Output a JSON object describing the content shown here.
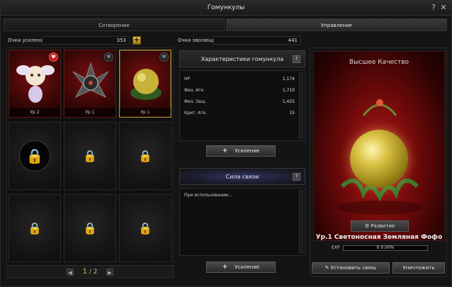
{
  "window": {
    "title": "Гомункулы"
  },
  "tabs": [
    {
      "label": "Сотворение"
    },
    {
      "label": "Управление"
    }
  ],
  "stats": {
    "enhance_label": "Очки усиления",
    "enhance_value": "353",
    "evolve_label": "Очки эволюции",
    "evolve_value": "441"
  },
  "slots": [
    {
      "level": "Ур 2",
      "favorite": true
    },
    {
      "level": "Ур 1",
      "favorite": false
    },
    {
      "level": "Ур 1",
      "favorite": false
    }
  ],
  "pager": {
    "current": "1",
    "total": "/ 2"
  },
  "attributes": {
    "title": "Характеристики гомункула",
    "rows": [
      {
        "label": "HP",
        "value": "1,174"
      },
      {
        "label": "Физ. Атк.",
        "value": "1,710"
      },
      {
        "label": "Физ. Защ.",
        "value": "1,425"
      },
      {
        "label": "Крит. Атк.",
        "value": "15"
      }
    ],
    "button": "Усиление"
  },
  "bond": {
    "title": "Сила связи",
    "text": "При использовании...",
    "button": "Усиление"
  },
  "detail": {
    "quality": "Высшее Качество",
    "evolve_button": "Развитие",
    "name": "Ур.1 Светоносная Земляная Фофо",
    "exp_label": "EXP",
    "exp_value": "0 0.00%",
    "bind_button": "Установить связь",
    "destroy_button": "Уничтожить"
  },
  "colors": {
    "accent_gold": "#b08c3a",
    "card_red": "#7a0f10"
  }
}
